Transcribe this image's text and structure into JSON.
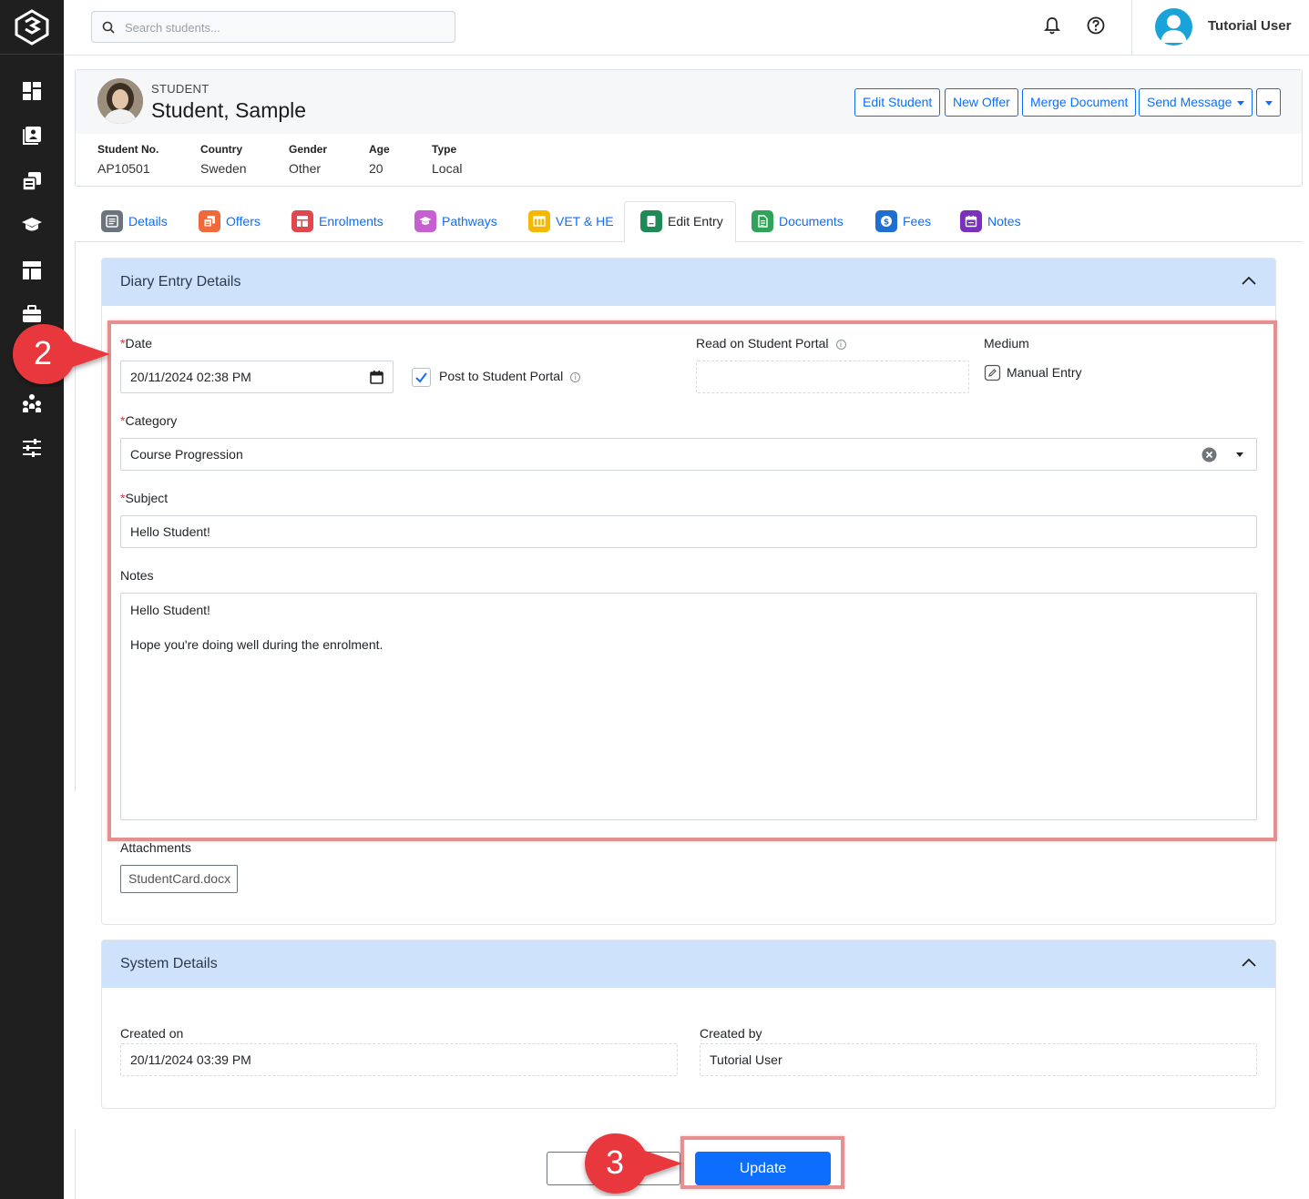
{
  "topbar": {
    "search_placeholder": "Search students...",
    "user_name": "Tutorial User"
  },
  "student": {
    "kicker": "STUDENT",
    "name": "Student, Sample",
    "actions": {
      "edit": "Edit Student",
      "new_offer": "New Offer",
      "merge": "Merge Document",
      "send_message": "Send Message"
    },
    "meta": [
      {
        "label": "Student No.",
        "value": "AP10501"
      },
      {
        "label": "Country",
        "value": "Sweden"
      },
      {
        "label": "Gender",
        "value": "Other"
      },
      {
        "label": "Age",
        "value": "20"
      },
      {
        "label": "Type",
        "value": "Local"
      }
    ]
  },
  "tabs": [
    {
      "label": "Details",
      "color": "#6c757d"
    },
    {
      "label": "Offers",
      "color": "#f0693b"
    },
    {
      "label": "Enrolments",
      "color": "#e0464e"
    },
    {
      "label": "Pathways",
      "color": "#c65fd0"
    },
    {
      "label": "VET & HE",
      "color": "#f5b800"
    },
    {
      "label": "Edit Entry",
      "color": "#1f8a56",
      "active": true
    },
    {
      "label": "Documents",
      "color": "#2ea35a"
    },
    {
      "label": "Fees",
      "color": "#1f6fd0"
    },
    {
      "label": "Notes",
      "color": "#7b2fbd"
    }
  ],
  "diary": {
    "title": "Diary Entry Details",
    "date_label": "Date",
    "date_value": "20/11/2024 02:38 PM",
    "post_to_portal_label": "Post to Student Portal",
    "post_to_portal_checked": true,
    "read_on_portal_label": "Read on Student Portal",
    "medium_label": "Medium",
    "medium_value": "Manual Entry",
    "category_label": "Category",
    "category_value": "Course Progression",
    "subject_label": "Subject",
    "subject_value": "Hello Student!",
    "notes_label": "Notes",
    "notes_line1": "Hello Student!",
    "notes_line2": "Hope you're doing well during the enrolment.",
    "attachments_label": "Attachments",
    "attachment_file": "StudentCard.docx"
  },
  "system": {
    "title": "System Details",
    "created_on_label": "Created on",
    "created_on_value": "20/11/2024 03:39 PM",
    "created_by_label": "Created by",
    "created_by_value": "Tutorial User"
  },
  "buttons": {
    "update": "Update"
  },
  "callouts": {
    "step2": "2",
    "step3": "3"
  },
  "colors": {
    "primary": "#0d6efd",
    "panel_header": "#cfe2fb",
    "highlight": "#e58f91",
    "callout": "#e8383d",
    "sidebar": "#1f1f1f"
  }
}
